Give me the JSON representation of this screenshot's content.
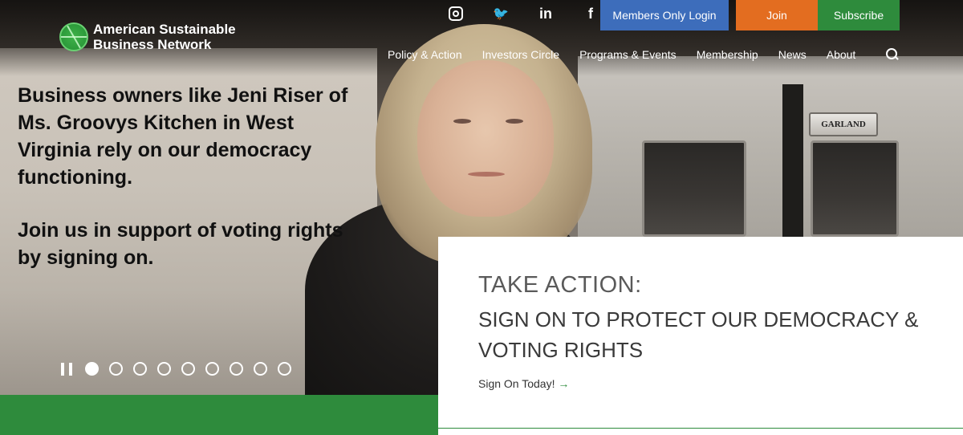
{
  "header": {
    "logo_text": "American Sustainable Business Network",
    "social": [
      "instagram-icon",
      "twitter-icon",
      "linkedin-icon",
      "facebook-icon"
    ],
    "social_glyphs": {
      "twitter": "🐦",
      "linkedin": "in",
      "facebook": "f"
    },
    "buttons": {
      "members": "Members Only Login",
      "join": "Join",
      "subscribe": "Subscribe"
    },
    "nav": [
      "Policy & Action",
      "Investors Circle",
      "Programs & Events",
      "Membership",
      "News",
      "About"
    ]
  },
  "hero": {
    "paragraph1": "Business owners like Jeni Riser of Ms. Groovys Kitchen in West Virginia rely on our democracy functioning.",
    "paragraph2": "Join us in support of voting rights by signing on.",
    "oven_brand": "GARLAND",
    "slider": {
      "total": 9,
      "active": 1
    }
  },
  "card": {
    "kicker": "TAKE ACTION:",
    "headline": "SIGN ON TO PROTECT OUR DEMOCRACY & VOTING RIGHTS",
    "link_text": "Sign On Today!",
    "link_arrow": "→"
  },
  "colors": {
    "members": "#3d6dbb",
    "join": "#e36d20",
    "subscribe": "#2e8b3c",
    "green_band": "#2e8b3c"
  }
}
